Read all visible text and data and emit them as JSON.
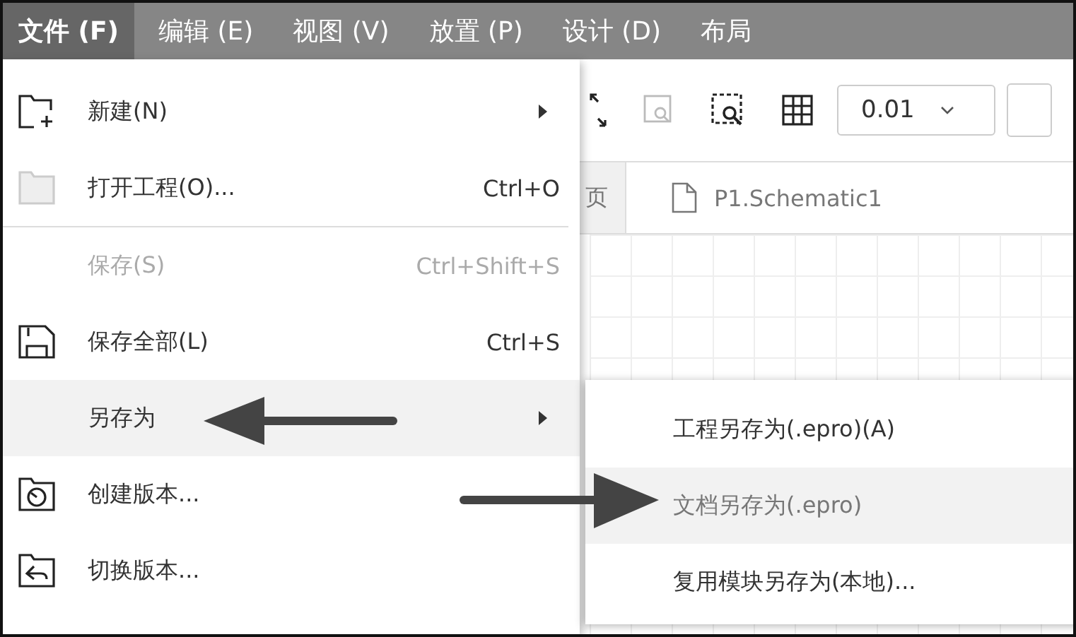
{
  "menubar": [
    {
      "label": "文件 (F)",
      "selected": true
    },
    {
      "label": "编辑 (E)",
      "selected": false
    },
    {
      "label": "视图 (V)",
      "selected": false
    },
    {
      "label": "放置 (P)",
      "selected": false
    },
    {
      "label": "设计 (D)",
      "selected": false
    },
    {
      "label": "布局",
      "selected": false
    }
  ],
  "toolbar": {
    "grid_size": {
      "value": "0.01"
    }
  },
  "tabs": [
    {
      "label": "页",
      "selected": false
    },
    {
      "label": "P1.Schematic1",
      "selected": true
    }
  ],
  "file_menu": {
    "items": [
      {
        "kind": "new",
        "label": "新建(N)",
        "submenu": true,
        "disabled": false,
        "selected": false
      },
      {
        "kind": "open",
        "label": "打开工程(O)...",
        "shortcut": "Ctrl+O",
        "submenu": false,
        "disabled": false,
        "selected": false,
        "divider_after": true
      },
      {
        "kind": "plain",
        "label": "保存(S)",
        "shortcut": "Ctrl+Shift+S",
        "submenu": false,
        "disabled": true,
        "selected": false
      },
      {
        "kind": "save-all",
        "label": "保存全部(L)",
        "shortcut": "Ctrl+S",
        "submenu": false,
        "disabled": false,
        "selected": false
      },
      {
        "kind": "plain",
        "label": "另存为",
        "submenu": true,
        "disabled": false,
        "selected": true
      },
      {
        "kind": "create-version",
        "label": "创建版本...",
        "submenu": false,
        "disabled": false,
        "selected": false
      },
      {
        "kind": "switch-version",
        "label": "切换版本...",
        "submenu": false,
        "disabled": false,
        "selected": false
      }
    ]
  },
  "save_as_submenu": {
    "items": [
      {
        "label": "工程另存为(.epro)(A)",
        "selected": false
      },
      {
        "label": "文档另存为(.epro)",
        "selected": true
      },
      {
        "label": "复用模块另存为(本地)...",
        "selected": false
      }
    ]
  }
}
